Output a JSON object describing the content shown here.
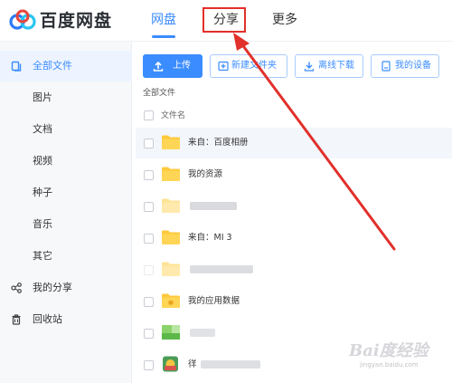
{
  "header": {
    "brand": "百度网盘",
    "nav": [
      {
        "label": "网盘",
        "active": true
      },
      {
        "label": "分享",
        "active": false
      },
      {
        "label": "更多",
        "active": false
      }
    ]
  },
  "sidebar": {
    "items": [
      {
        "label": "全部文件",
        "icon": "files-icon",
        "active": true
      },
      {
        "label": "图片"
      },
      {
        "label": "文档"
      },
      {
        "label": "视频"
      },
      {
        "label": "种子"
      },
      {
        "label": "音乐"
      },
      {
        "label": "其它"
      },
      {
        "label": "我的分享",
        "icon": "share-icon"
      },
      {
        "label": "回收站",
        "icon": "trash-icon"
      }
    ]
  },
  "toolbar": {
    "upload": "上传",
    "new_folder": "新建文件夹",
    "offline": "离线下载",
    "devices": "我的设备"
  },
  "breadcrumb": "全部文件",
  "columns": {
    "name": "文件名"
  },
  "files": [
    {
      "name": "来自：百度相册",
      "type": "folder"
    },
    {
      "name": "我的资源",
      "type": "folder"
    },
    {
      "name": "",
      "type": "folder",
      "blurred": true
    },
    {
      "name": "来自：MI 3",
      "type": "folder"
    },
    {
      "name": "",
      "type": "folder",
      "blurred": true
    },
    {
      "name": "我的应用数据",
      "type": "app-folder"
    },
    {
      "name": "",
      "type": "image",
      "blurred": true
    },
    {
      "name": "徉",
      "type": "app",
      "blurred": true
    }
  ],
  "watermark": {
    "text": "Bai度经验",
    "url": "jingyan.baidu.com"
  },
  "colors": {
    "accent": "#3b8cff",
    "folder": "#ffc93c",
    "highlight": "#e2302b"
  }
}
